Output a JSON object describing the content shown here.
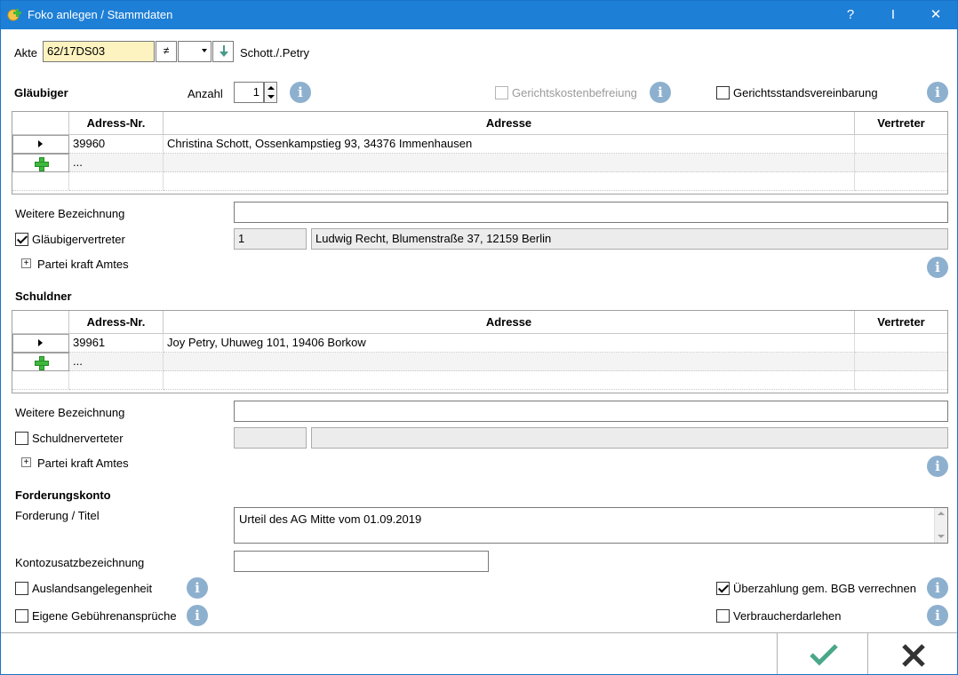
{
  "window": {
    "title": "Foko anlegen / Stammdaten",
    "help_glyph": "?",
    "min_glyph": "I",
    "close_glyph": "✕"
  },
  "akte": {
    "label": "Akte",
    "value": "62/17DS03",
    "mark_glyph": "≠",
    "parties": "Schott./.Petry"
  },
  "glaeubiger": {
    "heading": "Gläubiger",
    "anzahl_label": "Anzahl",
    "anzahl_value": "1",
    "gerichtskostenbefreiung": "Gerichtskostenbefreiung",
    "gerichtsstandsvereinbarung": "Gerichtsstandsvereinbarung",
    "columns": [
      "Adress-Nr.",
      "Adresse",
      "Vertreter"
    ],
    "rows": [
      {
        "nr": "39960",
        "adresse": "Christina Schott,  Ossenkampstieg 93,  34376 Immenhausen",
        "vertreter": ""
      }
    ],
    "new_row_text": "...",
    "weitere_label": "Weitere Bezeichnung",
    "weitere_value": "",
    "vertreter_label": "Gläubigervertreter",
    "vertreter_nr": "1",
    "vertreter_adresse": "Ludwig Recht,  Blumenstraße 37,  12159 Berlin",
    "partei_label": "Partei kraft Amtes"
  },
  "schuldner": {
    "heading": "Schuldner",
    "columns": [
      "Adress-Nr.",
      "Adresse",
      "Vertreter"
    ],
    "rows": [
      {
        "nr": "39961",
        "adresse": "Joy Petry,  Uhuweg 101,  19406 Borkow",
        "vertreter": ""
      }
    ],
    "new_row_text": "...",
    "weitere_label": "Weitere Bezeichnung",
    "weitere_value": "",
    "vertreter_label": "Schuldnerverteter",
    "vertreter_nr": "",
    "vertreter_adresse": "",
    "partei_label": "Partei kraft Amtes"
  },
  "forderung": {
    "heading": "Forderungskonto",
    "titel_label": "Forderung / Titel",
    "titel_value": "Urteil des AG Mitte vom 01.09.2019",
    "konto_label": "Kontozusatzbezeichnung",
    "konto_value": "",
    "ausland_label": "Auslandsangelegenheit",
    "gebuehren_label": "Eigene Gebührenansprüche",
    "ueberzahlung_label": "Überzahlung gem. BGB verrechnen",
    "verbraucher_label": "Verbraucherdarlehen"
  },
  "info_glyph": "i",
  "colors": {
    "titlebar": "#1e7fd6",
    "akte_field": "#fdf3c0",
    "info_icon": "#8eb0cf",
    "ok_check": "#4aa88a",
    "cancel_x": "#333333"
  }
}
